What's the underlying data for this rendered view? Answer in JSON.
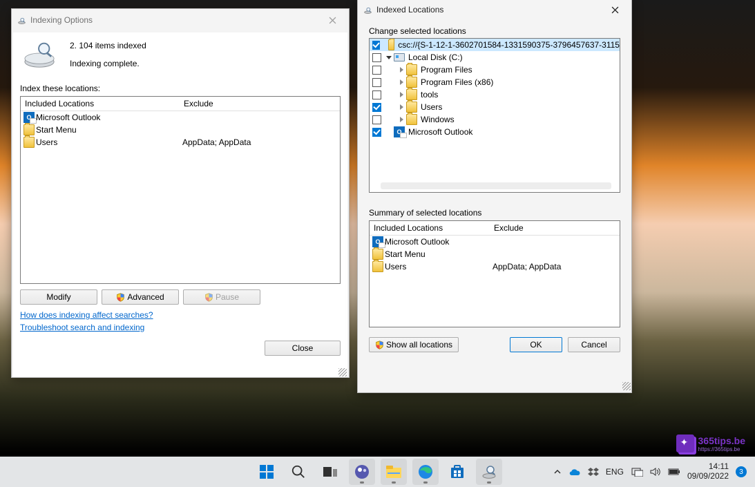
{
  "indexing_options": {
    "title": "Indexing Options",
    "status_count": "2. 104 items indexed",
    "status_text": "Indexing complete.",
    "locations_label": "Index these locations:",
    "columns": {
      "included": "Included Locations",
      "exclude": "Exclude"
    },
    "rows": [
      {
        "icon": "outlook",
        "name": "Microsoft Outlook",
        "exclude": ""
      },
      {
        "icon": "folder",
        "name": "Start Menu",
        "exclude": ""
      },
      {
        "icon": "folder",
        "name": "Users",
        "exclude": "AppData; AppData"
      }
    ],
    "buttons": {
      "modify": "Modify",
      "advanced": "Advanced",
      "pause": "Pause"
    },
    "links": {
      "how_affect": "How does indexing affect searches?",
      "troubleshoot": "Troubleshoot search and indexing"
    },
    "close": "Close"
  },
  "indexed_locations": {
    "title": "Indexed Locations",
    "change_label": "Change selected locations",
    "tree": [
      {
        "indent": 0,
        "checked": true,
        "selected": true,
        "expander": "",
        "icon": "folder",
        "label": "csc://{S-1-12-1-3602701584-1331590375-3796457637-3115"
      },
      {
        "indent": 0,
        "checked": false,
        "expander": "down",
        "icon": "disk",
        "label": "Local Disk (C:)"
      },
      {
        "indent": 1,
        "checked": false,
        "expander": "right",
        "icon": "folder",
        "label": "Program Files"
      },
      {
        "indent": 1,
        "checked": false,
        "expander": "right",
        "icon": "folder",
        "label": "Program Files (x86)"
      },
      {
        "indent": 1,
        "checked": false,
        "expander": "right",
        "icon": "folder",
        "label": "tools"
      },
      {
        "indent": 1,
        "checked": true,
        "expander": "right",
        "icon": "folder",
        "label": "Users"
      },
      {
        "indent": 1,
        "checked": false,
        "expander": "right",
        "icon": "folder",
        "label": "Windows"
      },
      {
        "indent": 0,
        "checked": true,
        "expander": "",
        "icon": "outlook",
        "label": "Microsoft Outlook"
      }
    ],
    "summary_label": "Summary of selected locations",
    "summary_columns": {
      "included": "Included Locations",
      "exclude": "Exclude"
    },
    "summary_rows": [
      {
        "icon": "outlook",
        "name": "Microsoft Outlook",
        "exclude": ""
      },
      {
        "icon": "folder",
        "name": "Start Menu",
        "exclude": ""
      },
      {
        "icon": "folder",
        "name": "Users",
        "exclude": "AppData; AppData"
      }
    ],
    "buttons": {
      "show_all": "Show all locations",
      "ok": "OK",
      "cancel": "Cancel"
    }
  },
  "taskbar": {
    "lang": "ENG",
    "time": "14:11",
    "date": "09/09/2022",
    "notif_count": "3"
  },
  "brand": {
    "name": "365tips.be",
    "tagline": "https://365tips.be"
  }
}
